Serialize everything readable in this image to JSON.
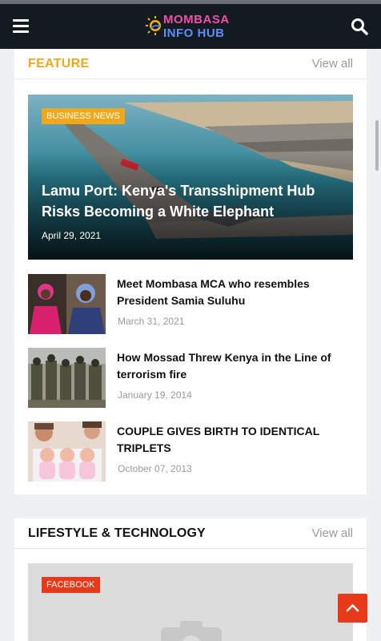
{
  "header": {
    "logo_line1": "MOMBASA",
    "logo_line2": "INFO HUB",
    "menu_icon": "hamburger-menu-icon",
    "search_icon": "search-icon"
  },
  "feature": {
    "title": "FEATURE",
    "view_all": "View all",
    "hero": {
      "category": "BUSINESS NEWS",
      "title": "Lamu Port: Kenya's Transshipment Hub Risks Becoming a White Elephant",
      "date": "April 29, 2021"
    },
    "items": [
      {
        "title": "Meet Mombasa MCA who resembles President Samia Suluhu",
        "date": "March 31, 2021"
      },
      {
        "title": "How Mossad Threw Kenya in the Line of terrorism fire",
        "date": "January 19, 2014"
      },
      {
        "title": "COUPLE GIVES BIRTH TO IDENTICAL TRIPLETS",
        "date": "October 07, 2013"
      }
    ]
  },
  "lifestyle": {
    "title": "LIFESTYLE & TECHNOLOGY",
    "view_all": "View all",
    "hero": {
      "category": "FACEBOOK",
      "placeholder_icon": "camera-placeholder-icon"
    }
  },
  "colors": {
    "accent_yellow": "#f0a81a",
    "accent_red": "#e8391a",
    "topbar": "#141a22"
  },
  "back_to_top_icon": "chevron-up-icon"
}
